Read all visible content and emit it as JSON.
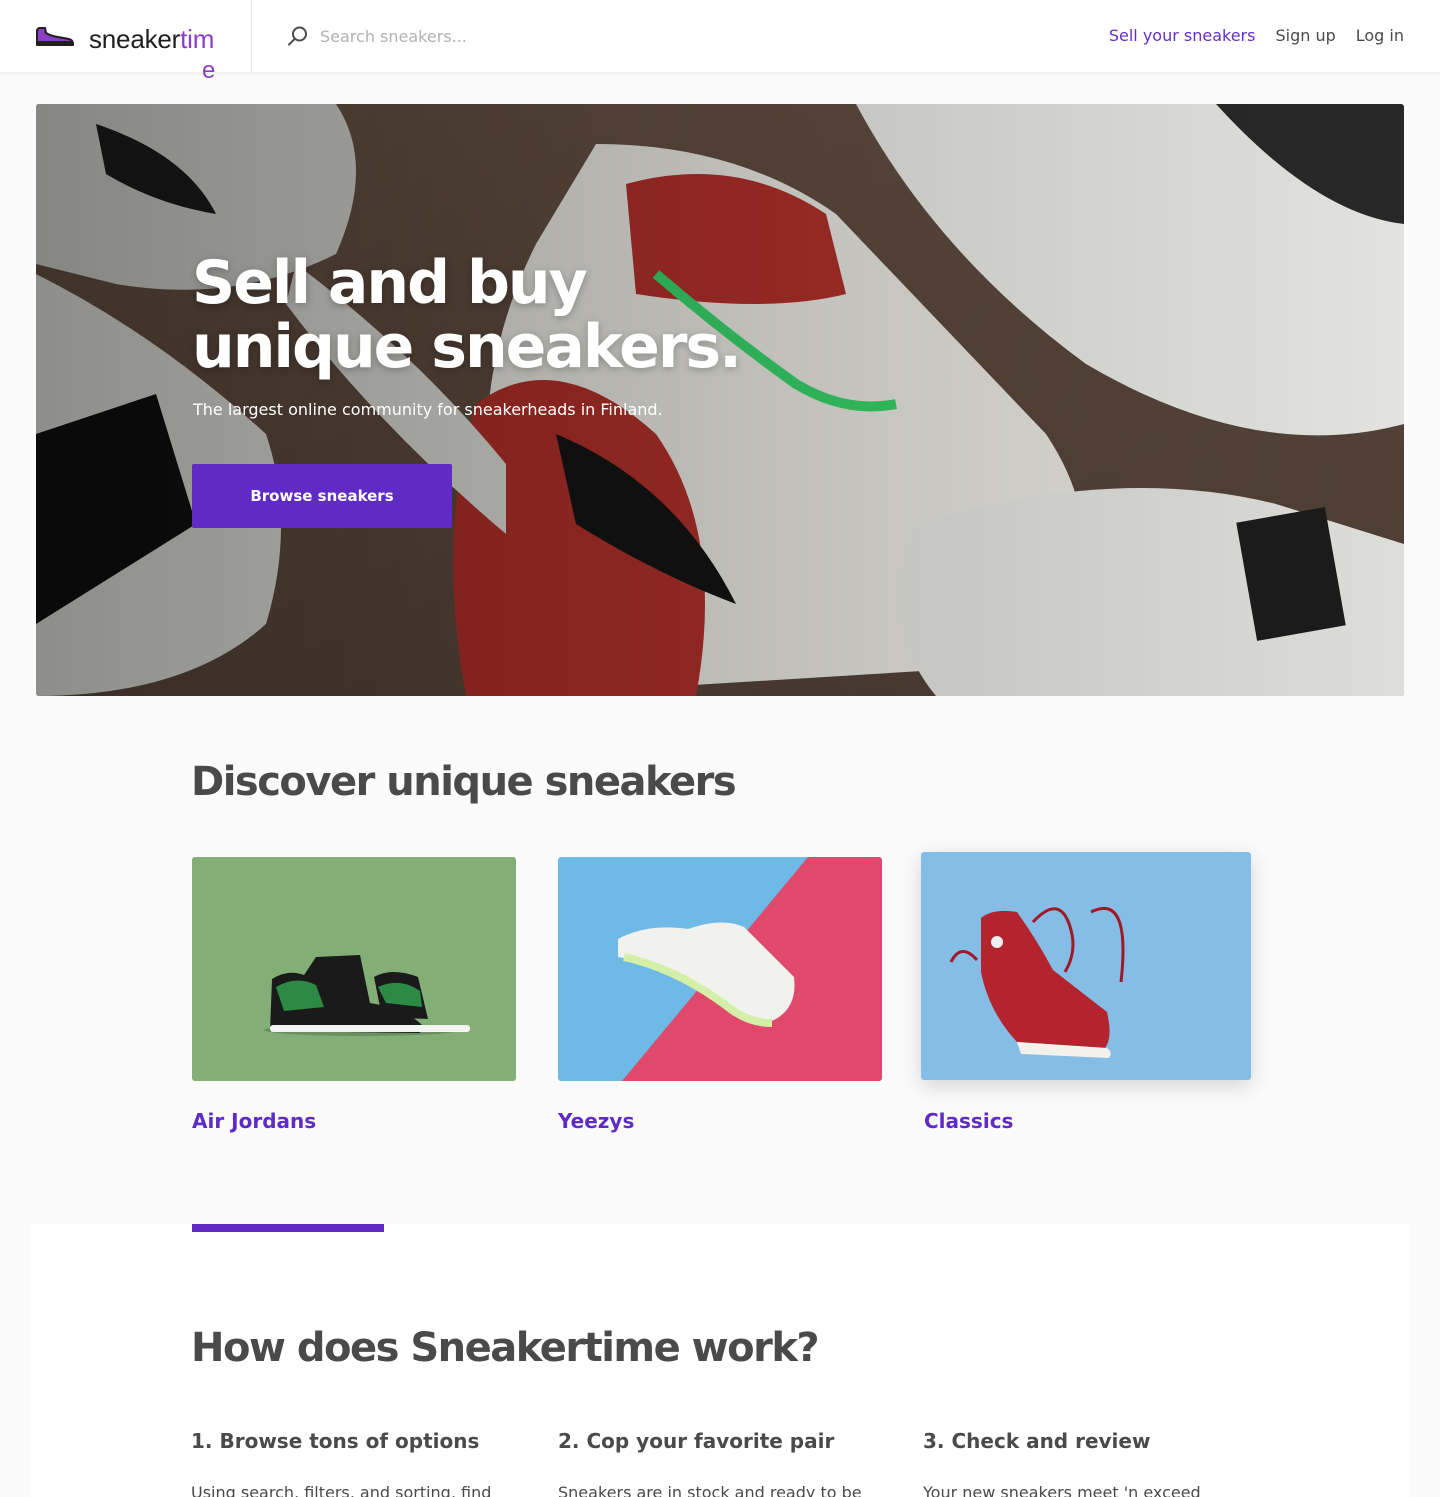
{
  "header": {
    "logo": {
      "text_main": "sneaker",
      "text_accent": "tim",
      "text_wrap": "e"
    },
    "search": {
      "placeholder": "Search sneakers..."
    },
    "nav": {
      "sell": "Sell your sneakers",
      "signup": "Sign up",
      "login": "Log in"
    }
  },
  "hero": {
    "title_line1": "Sell and buy",
    "title_line2": "unique sneakers.",
    "subtitle": "The largest online community for sneakerheads in Finland.",
    "button": "Browse sneakers"
  },
  "discover": {
    "title": "Discover unique sneakers",
    "cards": [
      {
        "label": "Air Jordans",
        "bg_color": "#83ae76"
      },
      {
        "label": "Yeezys",
        "bg_color": "#6eb9e6"
      },
      {
        "label": "Classics",
        "bg_color": "#86bde6"
      }
    ]
  },
  "how": {
    "title": "How does Sneakertime work?",
    "steps": [
      {
        "title": "1. Browse tons of options",
        "text": "Using search, filters, and sorting, find"
      },
      {
        "title": "2. Cop your favorite pair",
        "text": "Sneakers are in stock and ready to be"
      },
      {
        "title": "3. Check and review",
        "text": "Your new sneakers meet 'n exceed"
      }
    ]
  },
  "colors": {
    "brand": "#5f2bc4",
    "logo_accent": "#8c3ec6",
    "text": "#4a4a4a"
  }
}
